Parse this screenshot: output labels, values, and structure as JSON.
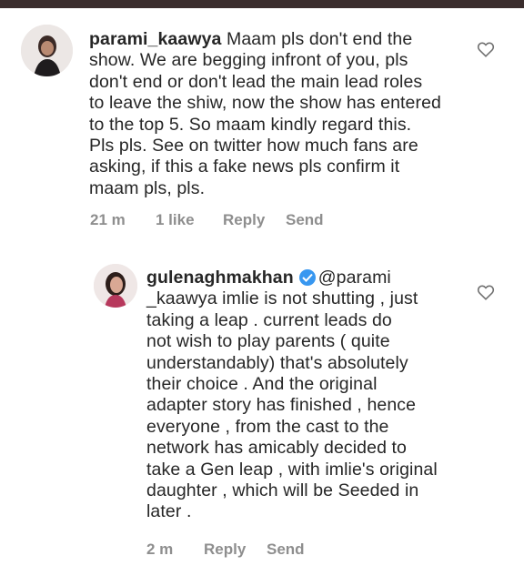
{
  "comments": [
    {
      "username": "parami_kaawya",
      "text": " Maam pls don't end the\nshow. We are begging infront of you, pls\ndon't end or don't lead the main lead roles\nto leave the shiw, now the show has entered\nto the top 5. So maam kindly regard this.\nPls pls. See on twitter how much fans are\nasking, if this a fake news pls confirm it\nmaam pls, pls.",
      "time": "21 m",
      "likes": "1 like",
      "reply_label": "Reply",
      "send_label": "Send"
    },
    {
      "username": "gulenaghmakhan",
      "mention": "@parami",
      "text": "_kaawya imlie is not shutting , just\ntaking a leap . current leads do\nnot wish to play parents ( quite\nunderstandably) that's absolutely\ntheir choice . And the original\nadapter story has finished , hence\neveryone , from the cast to the\nnetwork has amicably decided to\ntake a Gen leap , with imlie's original\ndaughter , which will be Seeded in\nlater .",
      "time": "2 m",
      "reply_label": "Reply",
      "send_label": "Send"
    }
  ],
  "icons": {
    "like": "heart-outline-icon",
    "verified": "verified-badge-icon"
  },
  "colors": {
    "text": "#262626",
    "meta": "#8e8e8e",
    "verified": "#3897f0",
    "topbar": "#3a2d2d"
  }
}
